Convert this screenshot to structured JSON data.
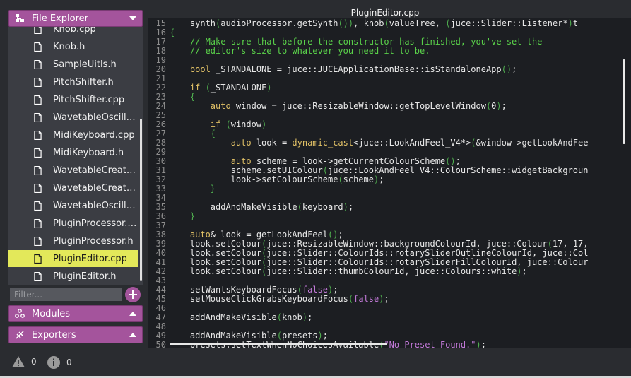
{
  "window_title": "PluginEditor.cpp",
  "sidebar": {
    "file_explorer_label": "File Explorer",
    "modules_label": "Modules",
    "exporters_label": "Exporters",
    "filter_placeholder": "Filter...",
    "files": [
      {
        "name": "Knob.cpp",
        "selected": false
      },
      {
        "name": "Knob.h",
        "selected": false
      },
      {
        "name": "SampleUitls.h",
        "selected": false
      },
      {
        "name": "PitchShifter.h",
        "selected": false
      },
      {
        "name": "PitchShifter.cpp",
        "selected": false
      },
      {
        "name": "WavetableOscillato...",
        "selected": false
      },
      {
        "name": "MidiKeyboard.cpp",
        "selected": false
      },
      {
        "name": "MidiKeyboard.h",
        "selected": false
      },
      {
        "name": "WavetableCreator....",
        "selected": false
      },
      {
        "name": "WavetableCreator.h",
        "selected": false
      },
      {
        "name": "WavetableOscillato...",
        "selected": false
      },
      {
        "name": "PluginProcessor.cpp",
        "selected": false
      },
      {
        "name": "PluginProcessor.h",
        "selected": false
      },
      {
        "name": "PluginEditor.cpp",
        "selected": true
      },
      {
        "name": "PluginEditor.h",
        "selected": false
      }
    ]
  },
  "editor": {
    "lines": [
      {
        "n": "15",
        "code": "    synth(audioProcessor.getSynth()), knob(valueTree, (juce::Slider::Listener*)t"
      },
      {
        "n": "16",
        "code": "{"
      },
      {
        "n": "17",
        "code": "    // Make sure that before the constructor has finished, you've set the"
      },
      {
        "n": "18",
        "code": "    // editor's size to whatever you need it to be."
      },
      {
        "n": "19",
        "code": ""
      },
      {
        "n": "20",
        "code": "    bool _STANDALONE = juce::JUCEApplicationBase::isStandaloneApp();"
      },
      {
        "n": "21",
        "code": ""
      },
      {
        "n": "22",
        "code": "    if (_STANDALONE)"
      },
      {
        "n": "23",
        "code": "    {"
      },
      {
        "n": "24",
        "code": "        auto window = juce::ResizableWindow::getTopLevelWindow(0);"
      },
      {
        "n": "25",
        "code": ""
      },
      {
        "n": "26",
        "code": "        if (window)"
      },
      {
        "n": "27",
        "code": "        {"
      },
      {
        "n": "28",
        "code": "            auto look = dynamic_cast<juce::LookAndFeel_V4*>(&window->getLookAndFee"
      },
      {
        "n": "29",
        "code": ""
      },
      {
        "n": "30",
        "code": "            auto scheme = look->getCurrentColourScheme();"
      },
      {
        "n": "31",
        "code": "            scheme.setUIColour(juce::LookAndFeel_V4::ColourScheme::widgetBackgroun"
      },
      {
        "n": "32",
        "code": "            look->setColourScheme(scheme);"
      },
      {
        "n": "33",
        "code": "        }"
      },
      {
        "n": "34",
        "code": ""
      },
      {
        "n": "35",
        "code": "        addAndMakeVisible(keyboard);"
      },
      {
        "n": "36",
        "code": "    }"
      },
      {
        "n": "37",
        "code": ""
      },
      {
        "n": "38",
        "code": "    auto& look = getLookAndFeel();"
      },
      {
        "n": "39",
        "code": "    look.setColour(juce::ResizableWindow::backgroundColourId, juce::Colour(17, 17,"
      },
      {
        "n": "40",
        "code": "    look.setColour(juce::Slider::ColourIds::rotarySliderOutlineColourId, juce::Col"
      },
      {
        "n": "41",
        "code": "    look.setColour(juce::Slider::ColourIds::rotarySliderFillColourId, juce::Colour"
      },
      {
        "n": "42",
        "code": "    look.setColour(juce::Slider::thumbColourId, juce::Colours::white);"
      },
      {
        "n": "43",
        "code": ""
      },
      {
        "n": "44",
        "code": "    setWantsKeyboardFocus(false);"
      },
      {
        "n": "45",
        "code": "    setMouseClickGrabsKeyboardFocus(false);"
      },
      {
        "n": "46",
        "code": ""
      },
      {
        "n": "47",
        "code": "    addAndMakeVisible(knob);"
      },
      {
        "n": "48",
        "code": ""
      },
      {
        "n": "49",
        "code": "    addAndMakeVisible(presets);"
      },
      {
        "n": "50",
        "code": "    presets.setTextWhenNoChoicesAvailable(\"No Preset Found.\");"
      }
    ]
  },
  "status": {
    "warnings": "0",
    "info": "0"
  },
  "colors": {
    "accent": "#a4549c",
    "selected": "#e3e85a",
    "editor_bg": "#1c1e22",
    "panel_bg": "#2a2c30"
  }
}
